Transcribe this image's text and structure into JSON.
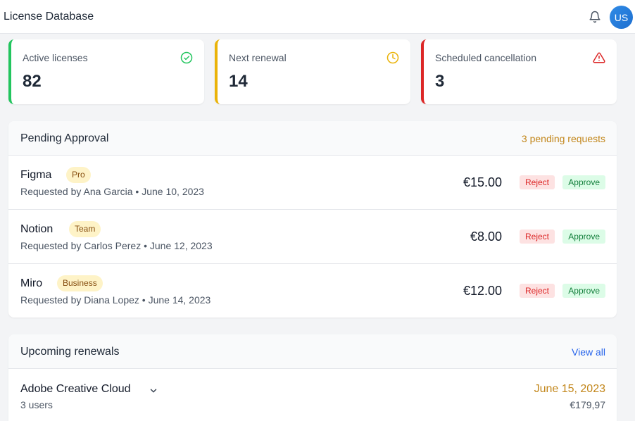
{
  "header": {
    "title": "License Database",
    "avatar_initials": "US"
  },
  "stats": [
    {
      "label": "Active licenses",
      "value": "82",
      "icon": "check-circle-icon",
      "color": "#22c55e"
    },
    {
      "label": "Next renewal",
      "value": "14",
      "icon": "clock-icon",
      "color": "#eab308"
    },
    {
      "label": "Scheduled cancellation",
      "value": "3",
      "icon": "alert-triangle-icon",
      "color": "#dc2626"
    }
  ],
  "pending": {
    "title": "Pending Approval",
    "count_text": "3 pending requests",
    "reject_label": "Reject",
    "approve_label": "Approve",
    "items": [
      {
        "name": "Figma",
        "plan": "Pro",
        "requested": "Requested by Ana Garcia • June 10, 2023",
        "price": "€15.00"
      },
      {
        "name": "Notion",
        "plan": "Team",
        "requested": "Requested by Carlos Perez • June 12, 2023",
        "price": "€8.00"
      },
      {
        "name": "Miro",
        "plan": "Business",
        "requested": "Requested by Diana Lopez • June 14, 2023",
        "price": "€12.00"
      }
    ]
  },
  "renewals": {
    "title": "Upcoming renewals",
    "view_all": "View all",
    "items": [
      {
        "name": "Adobe Creative Cloud",
        "users": "3 users",
        "date": "June 15, 2023",
        "amount": "€179,97"
      }
    ]
  }
}
